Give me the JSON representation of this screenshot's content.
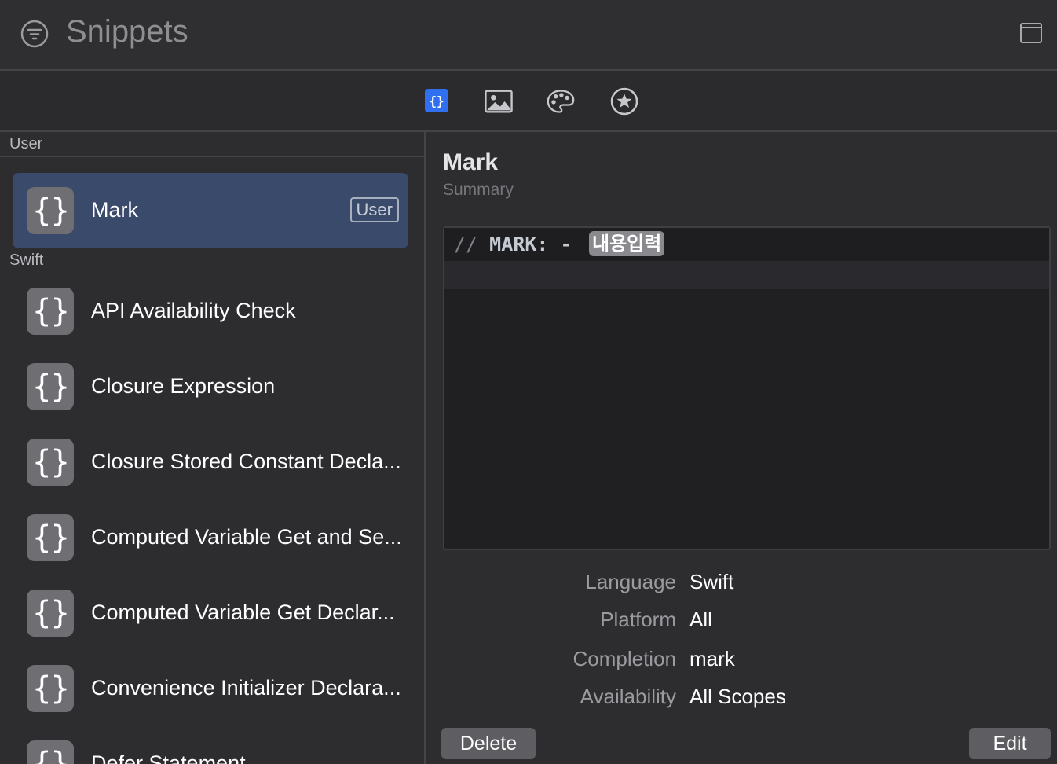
{
  "window": {
    "title": "Snippets"
  },
  "tabs": [
    {
      "name": "code-snippets",
      "icon": "braces-icon",
      "active": true
    },
    {
      "name": "media",
      "icon": "image-icon"
    },
    {
      "name": "colors",
      "icon": "palette-icon"
    },
    {
      "name": "symbols",
      "icon": "star-icon"
    }
  ],
  "sidebar": {
    "sections": [
      {
        "label": "User",
        "items": [
          {
            "label": "Mark",
            "badge": "User",
            "icon_text": "{}"
          }
        ]
      },
      {
        "label": "Swift",
        "items": [
          {
            "label": "API Availability Check",
            "icon_text": "{}"
          },
          {
            "label": "Closure Expression",
            "icon_text": "{}"
          },
          {
            "label": "Closure Stored Constant Decla...",
            "icon_text": "{}"
          },
          {
            "label": "Computed Variable Get and Se...",
            "icon_text": "{}"
          },
          {
            "label": "Computed Variable Get Declar...",
            "icon_text": "{}"
          },
          {
            "label": "Convenience Initializer Declara...",
            "icon_text": "{}"
          },
          {
            "label": "Defer Statement",
            "icon_text": "{}"
          }
        ]
      }
    ]
  },
  "detail": {
    "title": "Mark",
    "summary": "Summary",
    "code": {
      "comment": "//",
      "keyword": "MARK: -",
      "placeholder": "내용입력"
    },
    "meta": [
      {
        "key": "Language",
        "value": "Swift"
      },
      {
        "key": "Platform",
        "value": "All"
      },
      {
        "key": "Completion",
        "value": "mark"
      },
      {
        "key": "Availability",
        "value": "All Scopes"
      }
    ],
    "delete_label": "Delete",
    "edit_label": "Edit"
  },
  "colors": {
    "accent": "#2f6ff0",
    "selection": "#3a4a6a",
    "background": "#2d2d30"
  }
}
